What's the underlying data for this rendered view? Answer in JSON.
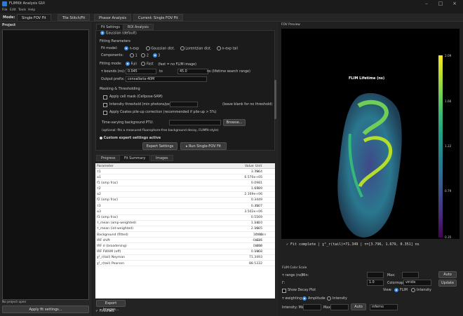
{
  "window": {
    "title": "FLIMKit Analysis GUI"
  },
  "menu": [
    "File",
    "Edit",
    "Tools",
    "Help"
  ],
  "mode": {
    "label": "Mode:",
    "tabs": [
      "Single FOV Fit",
      "Tile Stitch/Fit",
      "Phasor Analysis",
      "Current: Single FOV Fit"
    ]
  },
  "left": {
    "project_label": "Project",
    "status": "No project open",
    "apply_btn": "Apply fit settings..."
  },
  "center": {
    "tabs": [
      "Fit Settings",
      "ROI Analysis"
    ],
    "gaussian_partial": "Gaussian (default)",
    "fitting_params": "Fitting Parameters",
    "fit_model_label": "Fit model:",
    "fit_models": [
      "n-exp",
      "Gaussian dist.",
      "Lorentzian dist.",
      "n-exp tail"
    ],
    "components_label": "Components:",
    "components": [
      "1",
      "2",
      "3"
    ],
    "fitting_mode_label": "Fitting mode:",
    "fitting_modes": [
      "Full",
      "Fast"
    ],
    "fast_note": "(fast = no FLIM image)",
    "tau_label": "τ bounds (ns):",
    "tau_min": "0.045",
    "tau_to": "to",
    "tau_max": "45.0",
    "tau_unit": "ns",
    "tau_note": "(lifetime search range)",
    "prefix_label": "Output prefix:",
    "prefix_value": "convallaria-40M",
    "masking": "Masking & Thresholding",
    "apply_cell_mask": "Apply cell mask (Cellpose-SAM)",
    "intensity_threshold": "Intensity threshold (min photons/px):",
    "threshold_note": "(leave blank for no threshold)",
    "coates": "Apply Coates pile-up correction (recommended if pile-up > 5%)",
    "bg_label": "Time-varying background PTU:",
    "browse_btn": "Browse...",
    "bg_note": "(optional: fits a measured fluorophore-free background decay, FLIMfit-style)",
    "expert_active": "Custom expert settings active",
    "expert_btn": "Expert Settings",
    "run_btn": "▸ Run Single-FOV Fit",
    "result_tabs": [
      "Progress",
      "Fit Summary",
      "Images"
    ],
    "table_headers": [
      "Parameter",
      "Value",
      "Unit"
    ],
    "rows": [
      [
        "τ1",
        "3.7964",
        "ns"
      ],
      [
        "α1",
        "6.570e+05",
        ""
      ],
      [
        "f1 (amp frac)",
        "0.0981",
        ""
      ],
      [
        "τ2",
        "1.6789",
        "ns"
      ],
      [
        "α2",
        "2.169e+06",
        ""
      ],
      [
        "f2 (amp frac)",
        "0.3449",
        ""
      ],
      [
        "τ3",
        "0.3507",
        "ns"
      ],
      [
        "α3",
        "3.502e+06",
        ""
      ],
      [
        "f3 (amp frac)",
        "0.5569",
        ""
      ],
      [
        "τ_mean (amp-weighted)",
        "1.1410",
        "ns"
      ],
      [
        "τ_mean (int-weighted)",
        "2.1605",
        "ns"
      ],
      [
        "Background (fitted)",
        "10.00",
        "cts/bin"
      ],
      [
        "IRF shift",
        "-0.625",
        "bins"
      ],
      [
        "IRF σ (broadening)",
        "0.000",
        "bins"
      ],
      [
        "IRF FWHM (eff)",
        "0.1968",
        "ns"
      ],
      [
        "χ²_r(tail) Neyman",
        "71.3493",
        ""
      ],
      [
        "χ²_r(tail) Pearson",
        "88.5332",
        ""
      ]
    ],
    "export_btn": "Export Images...",
    "finished": "✓  Finished."
  },
  "right": {
    "preview_label": "FOV Preview",
    "plot_title": "FLIM Lifetime (ns)",
    "cbar_ticks": [
      "2.09",
      "1.66",
      "1.22",
      "0.79",
      "0.35"
    ],
    "status_text": "✓ Fit complete | χ²_r(tail)=71.349 | τ=[3.796, 1.679, 0.351] ns",
    "color_scale": "FLIM Color Scale",
    "range_label": "τ range (ns):",
    "min_label": "Min:",
    "max_label": "Max:",
    "auto_btn": "Auto",
    "gamma_label": "Γ:",
    "gamma_value": "1.0",
    "colormap_label": "Colormap:",
    "colormap_value": "viridis",
    "update_btn": "Update",
    "show_decay": "Show Decay Plot",
    "view_label": "View:",
    "view_options": [
      "FLIM",
      "Intensity"
    ],
    "weighting_label": "τ weighting:",
    "weighting_options": [
      "Amplitude",
      "Intensity"
    ],
    "intensity_label": "Intensity: Min",
    "int_max_label": "Max",
    "int_auto_btn": "Auto",
    "int_cmap": "inferno"
  },
  "colors": {
    "accent": "#3b8eea",
    "viridis_top": "#fde725",
    "viridis_bottom": "#440154"
  }
}
